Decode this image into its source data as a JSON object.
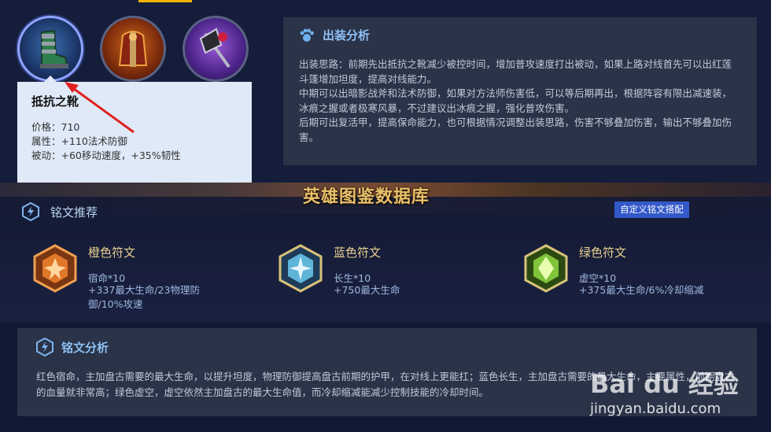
{
  "items": [
    {
      "name": "boots-of-resistance",
      "selected": true
    },
    {
      "name": "crimson-cloak",
      "selected": false
    },
    {
      "name": "shadow-axe",
      "selected": false
    }
  ],
  "tooltip": {
    "name": "抵抗之靴",
    "price": "价格：710",
    "attribute": "属性：+110法术防御",
    "passive": "被动：+60移动速度，+35%韧性"
  },
  "build": {
    "title": "出装分析",
    "lines": [
      "出装思路：前期先出抵抗之靴减少被控时间，增加普攻速度打出被动，如果上路对线首先可以出红莲斗篷增加坦度，提高对线能力。",
      "中期可以出暗影战斧和法术防御，如果对方法师伤害低，可以等后期再出，根据阵容有限出减速装，冰痕之握或者极寒风暴，不过建议出冰痕之握，强化普攻伤害。",
      "后期可出复活甲，提高保命能力，也可根据情况调整出装思路，伤害不够叠加伤害，输出不够叠加伤害。"
    ]
  },
  "banner": {
    "text": "英雄图鉴数据库"
  },
  "runes": {
    "title": "铭文推荐",
    "custom_button": "自定义铭文搭配",
    "list": [
      {
        "color_name": "橙色符文",
        "count": "宿命*10",
        "stat": "+337最大生命/23物理防御/10%攻速",
        "color": "#e0782a"
      },
      {
        "color_name": "蓝色符文",
        "count": "长生*10",
        "stat": "+750最大生命",
        "color": "#5fb5d8"
      },
      {
        "color_name": "绿色符文",
        "count": "虚空*10",
        "stat": "+375最大生命/6%冷却缩减",
        "color": "#7fc43a"
      }
    ]
  },
  "rune_analysis": {
    "title": "铭文分析",
    "text": "红色宿命，主加盘古需要的最大生命，以提升坦度，物理防御提高盘古前期的护甲，在对线上更能扛；蓝色长生，主加盘古需要的最大生命，主要属性，前期盘古的血量就非常高；绿色虚空，虚空依然主加盘古的最大生命值，而冷却缩减能减少控制技能的冷却时间。"
  },
  "watermark": {
    "logo": "Bai du 经验",
    "url": "jingyan.baidu.com"
  },
  "colors": {
    "accent_blue": "#3359c9",
    "panel": "#2a3348",
    "rune_title": "#e8cf8e",
    "highlight": "#f0b400"
  }
}
